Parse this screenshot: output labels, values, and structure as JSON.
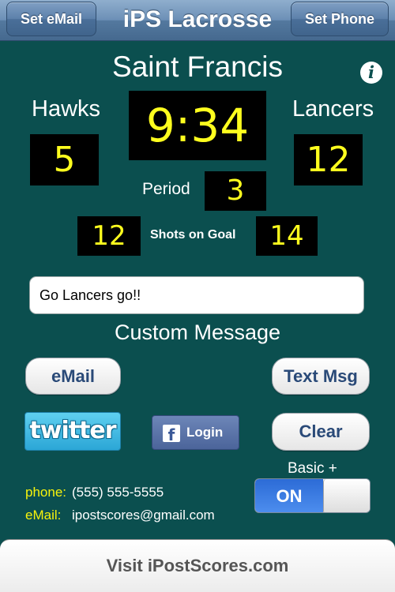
{
  "navbar": {
    "title": "iPS Lacrosse",
    "left_button": "Set eMail",
    "right_button": "Set Phone"
  },
  "game": {
    "venue": "Saint Francis",
    "home_team": "Hawks",
    "away_team": "Lancers",
    "clock": "9:34",
    "home_score": "5",
    "away_score": "12",
    "period_label": "Period",
    "period": "3",
    "shots_label": "Shots on Goal",
    "home_shots": "12",
    "away_shots": "14"
  },
  "info_icon": {
    "glyph": "i",
    "icon": "info-icon"
  },
  "message": {
    "value": "Go Lancers go!!",
    "label": "Custom Message"
  },
  "buttons": {
    "email": "eMail",
    "text_msg": "Text Msg",
    "twitter": "twitter",
    "facebook_glyph": "f",
    "facebook_login": "Login",
    "clear": "Clear"
  },
  "basic_plus": {
    "label": "Basic +",
    "state": "ON"
  },
  "contact": {
    "phone_label": "phone:",
    "phone": "(555) 555-5555",
    "email_label": "eMail:",
    "email": "ipostscores@gmail.com"
  },
  "footer": {
    "label": "Visit iPostScores.com"
  },
  "colors": {
    "background": "#0b4f4f",
    "digits": "#ffff1e",
    "contact_key": "#f7f30c",
    "button_text": "#2a4a78",
    "toggle_on": "#2c6bd6"
  }
}
